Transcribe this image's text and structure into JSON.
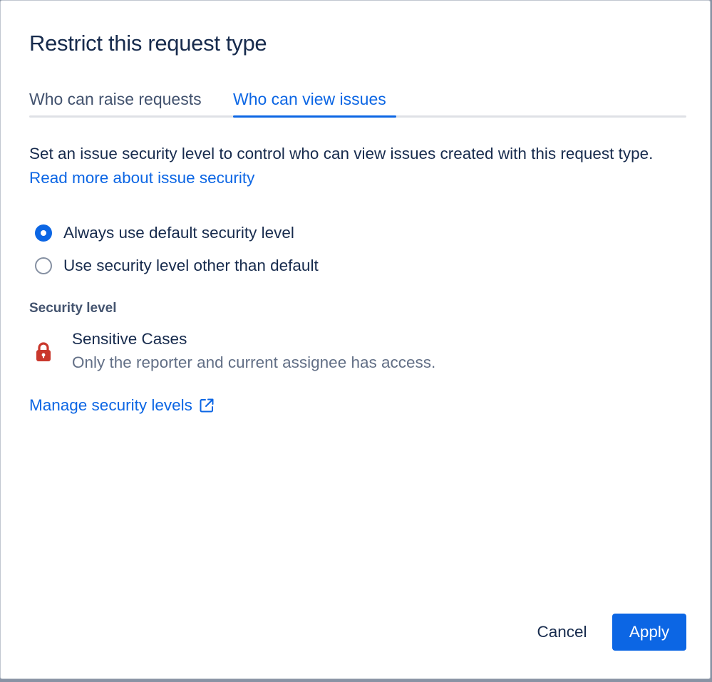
{
  "dialog": {
    "title": "Restrict this request type"
  },
  "tabs": [
    {
      "label": "Who can raise requests",
      "selected": false
    },
    {
      "label": "Who can view issues",
      "selected": true
    }
  ],
  "description": {
    "text": "Set an issue security level to control who can view issues created with this request type. ",
    "link_label": "Read more about issue security"
  },
  "radio_options": [
    {
      "label": "Always use default security level",
      "checked": true
    },
    {
      "label": "Use security level other than default",
      "checked": false
    }
  ],
  "security_level": {
    "section_label": "Security level",
    "icon": "lock-icon",
    "icon_color": "#c9372c",
    "name": "Sensitive Cases",
    "description": "Only the reporter and current assignee has access."
  },
  "manage_link": {
    "label": "Manage security levels",
    "icon": "external-link-icon"
  },
  "footer": {
    "cancel_label": "Cancel",
    "apply_label": "Apply"
  },
  "colors": {
    "accent": "#0c66e4",
    "text": "#172b4d",
    "subtle_text": "#626f86"
  }
}
